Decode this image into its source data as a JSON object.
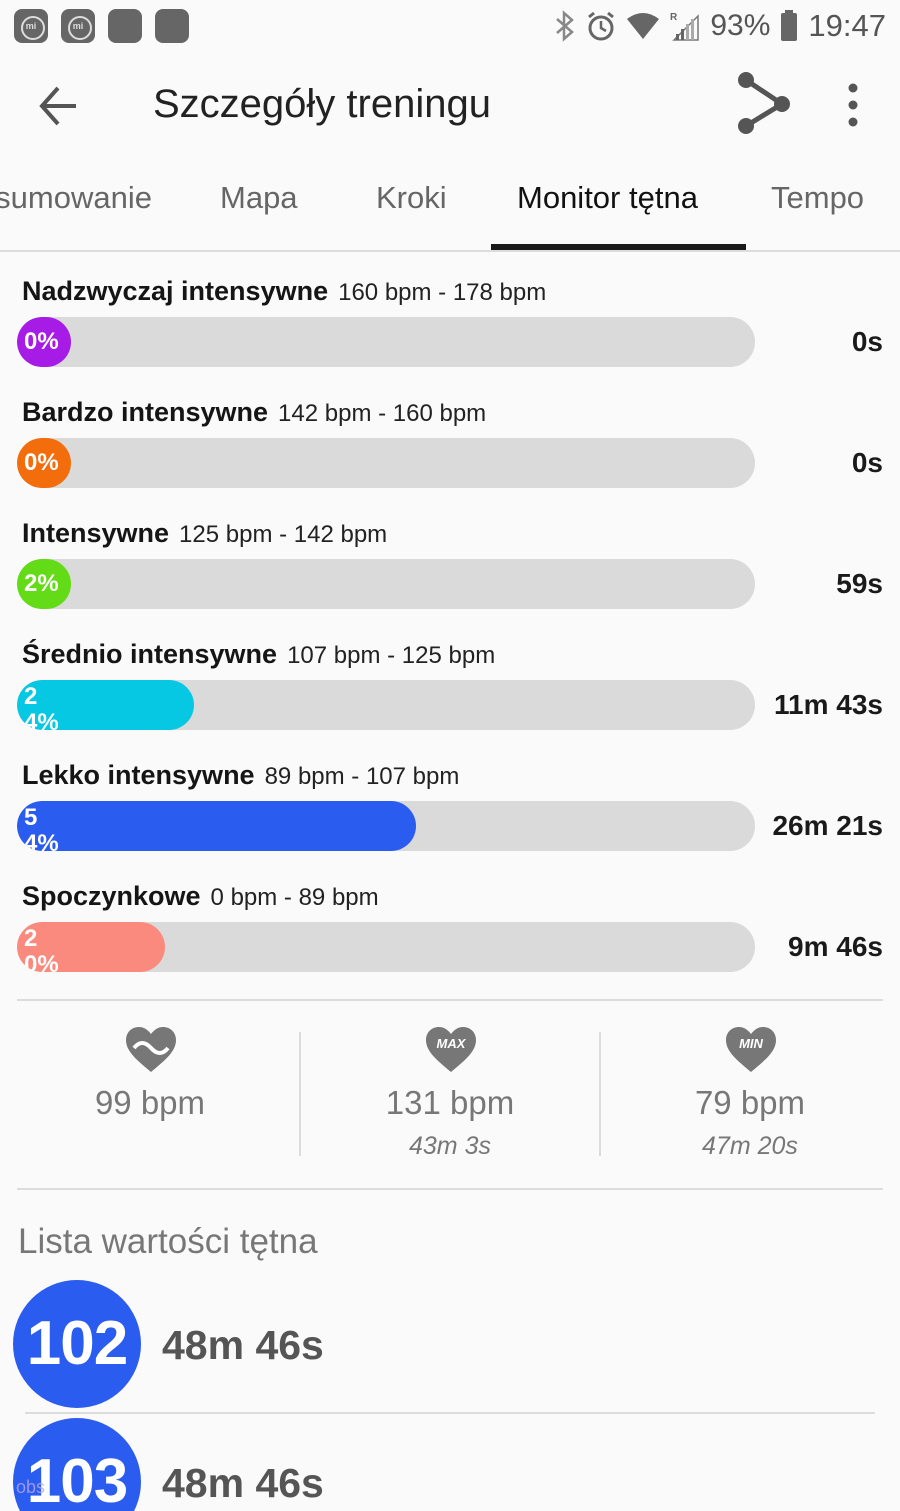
{
  "status_bar": {
    "app_icons": [
      "mi-fit-icon",
      "mi-fit-icon",
      "app-icon",
      "app-icon"
    ],
    "battery_pct": "93%",
    "time": "19:47"
  },
  "toolbar": {
    "title": "Szczegóły treningu"
  },
  "tabs": [
    {
      "label": "Podsumowanie",
      "active": false
    },
    {
      "label": "Mapa",
      "active": false
    },
    {
      "label": "Kroki",
      "active": false
    },
    {
      "label": "Monitor tętna",
      "active": true
    },
    {
      "label": "Tempo",
      "active": false
    }
  ],
  "zones": [
    {
      "name": "Nadzwyczaj intensywne",
      "range": "160 bpm - 178 bpm",
      "pct_label": "0%",
      "fraction": 0.0,
      "time": "0s",
      "color": "#a61be6"
    },
    {
      "name": "Bardzo intensywne",
      "range": "142 bpm - 160 bpm",
      "pct_label": "0%",
      "fraction": 0.0,
      "time": "0s",
      "color": "#f46d0c"
    },
    {
      "name": "Intensywne",
      "range": "125 bpm - 142 bpm",
      "pct_label": "2%",
      "fraction": 0.02,
      "time": "59s",
      "color": "#63db16"
    },
    {
      "name": "Średnio intensywne",
      "range": "107 bpm - 125 bpm",
      "pct_label": "24%",
      "fraction": 0.24,
      "time": "11m 43s",
      "color": "#07c8e2"
    },
    {
      "name": "Lekko intensywne",
      "range": "89 bpm - 107 bpm",
      "pct_label": "54%",
      "fraction": 0.54,
      "time": "26m 21s",
      "color": "#2a5cf0"
    },
    {
      "name": "Spoczynkowe",
      "range": "0 bpm - 89 bpm",
      "pct_label": "20%",
      "fraction": 0.2,
      "time": "9m 46s",
      "color": "#fb8a7e"
    }
  ],
  "stats": {
    "avg": {
      "icon": "heart-average-icon",
      "value": "99 bpm"
    },
    "max": {
      "icon": "heart-max-icon",
      "icon_text": "MAX",
      "value": "131 bpm",
      "sub": "43m 3s"
    },
    "min": {
      "icon": "heart-min-icon",
      "icon_text": "MIN",
      "value": "79 bpm",
      "sub": "47m 20s"
    }
  },
  "heart_list": {
    "title": "Lista wartości tętna",
    "items": [
      {
        "bpm": "102",
        "time": "48m 46s"
      },
      {
        "bpm": "103",
        "time": "48m 46s"
      }
    ]
  },
  "watermark": "obs"
}
